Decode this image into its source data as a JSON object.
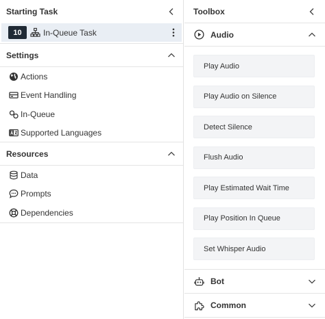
{
  "left_panel": {
    "starting_task": {
      "title": "Starting Task",
      "task_number": "10",
      "task_label": "In-Queue Task"
    },
    "settings": {
      "title": "Settings",
      "items": [
        {
          "label": "Actions",
          "icon": "globe-icon"
        },
        {
          "label": "Event Handling",
          "icon": "event-icon"
        },
        {
          "label": "In-Queue",
          "icon": "queue-icon"
        },
        {
          "label": "Supported Languages",
          "icon": "language-icon"
        }
      ]
    },
    "resources": {
      "title": "Resources",
      "items": [
        {
          "label": "Data",
          "icon": "database-icon"
        },
        {
          "label": "Prompts",
          "icon": "speech-bubble-icon"
        },
        {
          "label": "Dependencies",
          "icon": "lifebuoy-icon"
        }
      ]
    }
  },
  "toolbox": {
    "title": "Toolbox",
    "audio": {
      "label": "Audio",
      "tools": [
        "Play Audio",
        "Play Audio on Silence",
        "Detect Silence",
        "Flush Audio",
        "Play Estimated Wait Time",
        "Play Position In Queue",
        "Set Whisper Audio"
      ]
    },
    "bot": {
      "label": "Bot"
    },
    "common": {
      "label": "Common"
    }
  },
  "colors": {
    "task_number_bg": "#202a35",
    "selected_row_bg": "#e9eef4",
    "tool_bg": "#f3f4f6"
  }
}
